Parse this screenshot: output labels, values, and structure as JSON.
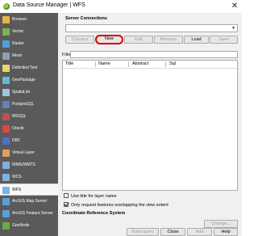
{
  "window": {
    "title": "Data Source Manager | WFS",
    "close_glyph": "✕"
  },
  "sidebar": {
    "items": [
      {
        "label": "Browser",
        "icon": "browser-icon",
        "color": "#e8b54a"
      },
      {
        "label": "Vector",
        "icon": "vector-icon",
        "color": "#7fb24a"
      },
      {
        "label": "Raster",
        "icon": "raster-icon",
        "color": "#4f9fd6"
      },
      {
        "label": "Mesh",
        "icon": "mesh-icon",
        "color": "#8fa0b0"
      },
      {
        "label": "Delimited Text",
        "icon": "delimited-text-icon",
        "color": "#e9d36a"
      },
      {
        "label": "GeoPackage",
        "icon": "geopackage-icon",
        "color": "#6ab7d0"
      },
      {
        "label": "SpatiaLite",
        "icon": "spatialite-icon",
        "color": "#9fc3e0"
      },
      {
        "label": "PostgreSQL",
        "icon": "postgresql-icon",
        "color": "#5d86b5"
      },
      {
        "label": "MSSQL",
        "icon": "mssql-icon",
        "color": "#c05050"
      },
      {
        "label": "Oracle",
        "icon": "oracle-icon",
        "color": "#d94a3a"
      },
      {
        "label": "DB2",
        "icon": "db2-icon",
        "color": "#4a72c4"
      },
      {
        "label": "Virtual Layer",
        "icon": "virtual-layer-icon",
        "color": "#e0a060"
      },
      {
        "label": "WMS/WMTS",
        "icon": "wms-icon",
        "color": "#7fb0e0"
      },
      {
        "label": "WCS",
        "icon": "wcs-icon",
        "color": "#7fb0e0"
      },
      {
        "label": "WFS",
        "icon": "wfs-icon",
        "color": "#7fb0e0"
      },
      {
        "label": "ArcGIS Map Server",
        "icon": "arcgis-map-icon",
        "color": "#5aa0d8"
      },
      {
        "label": "ArcGIS Feature Server",
        "icon": "arcgis-feature-icon",
        "color": "#5aa0d8"
      },
      {
        "label": "GeoNode",
        "icon": "geonode-icon",
        "color": "#6fa84a"
      }
    ],
    "active_index": 14
  },
  "server_connections": {
    "title": "Server Connections",
    "buttons": {
      "connect": "Connect",
      "new": "New",
      "edit": "Edit",
      "remove": "Remove",
      "load": "Load",
      "save": "Save"
    }
  },
  "filter": {
    "label": "Filter",
    "value": ""
  },
  "table": {
    "columns": [
      "Title",
      "Name",
      "Abstract",
      "Sql"
    ]
  },
  "options": {
    "use_title": {
      "label": "Use title for layer name",
      "checked": false
    },
    "only_request": {
      "label": "Only request features overlapping the view extent",
      "checked": true
    }
  },
  "crs": {
    "title": "Coordinate Reference System",
    "change_label": "Change..."
  },
  "footer": {
    "build_query": "Build query",
    "close": "Close",
    "add": "Add",
    "help": "Help"
  }
}
